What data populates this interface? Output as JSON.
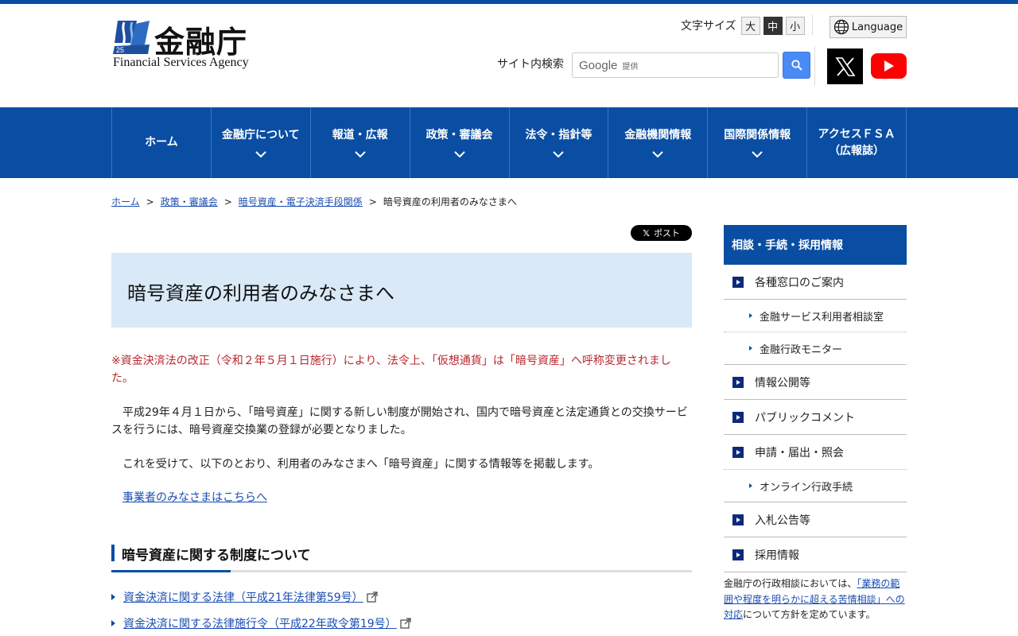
{
  "header": {
    "logo_jp": "金融庁",
    "logo_en": "Financial Services Agency",
    "font_size_label": "文字サイズ",
    "font_sizes": [
      "大",
      "中",
      "小"
    ],
    "font_size_selected": "中",
    "language_label": "Language",
    "search_label": "サイト内検索",
    "search_brand": "Google",
    "search_brand_suffix": "提供"
  },
  "nav": {
    "items": [
      {
        "label": "ホーム"
      },
      {
        "label": "金融庁について"
      },
      {
        "label": "報道・広報"
      },
      {
        "label": "政策・審議会"
      },
      {
        "label": "法令・指針等"
      },
      {
        "label": "金融機関情報"
      },
      {
        "label": "国際関係情報"
      },
      {
        "label_line1": "アクセスＦＳＡ",
        "label_line2": "（広報誌）"
      }
    ]
  },
  "breadcrumb": {
    "items": [
      "ホーム",
      "政策・審議会",
      "暗号資産・電子決済手段関係"
    ],
    "current": "暗号資産の利用者のみなさまへ",
    "separator": ">"
  },
  "share": {
    "post_label": "ポスト"
  },
  "main": {
    "title": "暗号資産の利用者のみなさまへ",
    "notice": "※資金決済法の改正（令和２年５月１日施行）により、法令上、「仮想通貨」は「暗号資産」へ呼称変更されました。",
    "para1": "平成29年４月１日から、「暗号資産」に関する新しい制度が開始され、国内で暗号資産と法定通貨との交換サービスを行うには、暗号資産交換業の登録が必要となりました。",
    "para2": "これを受けて、以下のとおり、利用者のみなさまへ「暗号資産」に関する情報等を掲載します。",
    "biz_link": "事業者のみなさまはこちらへ",
    "section_title": "暗号資産に関する制度について",
    "laws": [
      "資金決済に関する法律（平成21年法律第59号）",
      "資金決済に関する法律施行令（平成22年政令第19号）"
    ]
  },
  "sidebar": {
    "heading": "相談・手続・採用情報",
    "items": [
      {
        "type": "main",
        "label": "各種窓口のご案内"
      },
      {
        "type": "sub",
        "label": "金融サービス利用者相談室"
      },
      {
        "type": "sub",
        "label": "金融行政モニター",
        "last": true
      },
      {
        "type": "main",
        "label": "情報公開等"
      },
      {
        "type": "main",
        "label": "パブリックコメント"
      },
      {
        "type": "main",
        "label": "申請・届出・照会"
      },
      {
        "type": "sub",
        "label": "オンライン行政手続",
        "last": true
      },
      {
        "type": "main",
        "label": "入札公告等"
      },
      {
        "type": "main",
        "label": "採用情報"
      }
    ],
    "note_before": "金融庁の行政相談においては、",
    "note_link": "「業務の範囲や程度を明らかに超える苦情相談」への対応",
    "note_after": "について方針を定めています。"
  },
  "colors": {
    "brand_blue": "#0a4ea3",
    "notice_red": "#b7282e",
    "title_bg": "#d9e9f8"
  }
}
